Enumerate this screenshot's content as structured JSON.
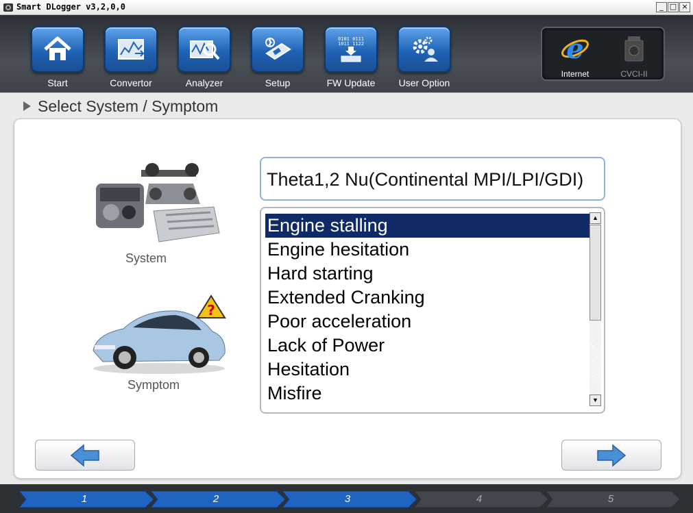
{
  "window": {
    "title": "Smart DLogger v3,2,0,0",
    "minimize": "_",
    "restore": "□",
    "close": "×"
  },
  "toolbar": {
    "items": [
      {
        "id": "start",
        "label": "Start",
        "icon": "home-icon"
      },
      {
        "id": "convertor",
        "label": "Convertor",
        "icon": "convertor-icon"
      },
      {
        "id": "analyzer",
        "label": "Analyzer",
        "icon": "analyzer-icon"
      },
      {
        "id": "setup",
        "label": "Setup",
        "icon": "setup-icon"
      },
      {
        "id": "fw_update",
        "label": "FW Update",
        "icon": "chip-download-icon"
      },
      {
        "id": "user_option",
        "label": "User Option",
        "icon": "user-gear-icon"
      }
    ],
    "devices": [
      {
        "label": "Internet",
        "icon": "internet-explorer-icon",
        "active": true
      },
      {
        "label": "CVCI-II",
        "icon": "vci-device-icon",
        "active": false
      }
    ],
    "fw_icon_text": [
      "0101 0111",
      "1011 1122"
    ]
  },
  "header": {
    "title": "Select System / Symptom"
  },
  "left": {
    "system_label": "System",
    "symptom_label": "Symptom"
  },
  "system_field": {
    "value": "Theta1,2 Nu(Continental MPI/LPI/GDI)"
  },
  "symptoms": {
    "selected_index": 0,
    "items": [
      "Engine stalling",
      "Engine hesitation",
      "Hard starting",
      "Extended Cranking",
      "Poor acceleration",
      "Lack of Power",
      "Hesitation",
      "Misfire"
    ]
  },
  "scrollbar": {
    "up": "▲",
    "down": "▼"
  },
  "progress": {
    "steps": [
      "1",
      "2",
      "3",
      "4",
      "5"
    ],
    "current": 3
  },
  "colors": {
    "accent_blue": "#1f63b6",
    "selection": "#0f2a66",
    "step_active": "#1e64c0",
    "step_inactive": "#43474d"
  }
}
